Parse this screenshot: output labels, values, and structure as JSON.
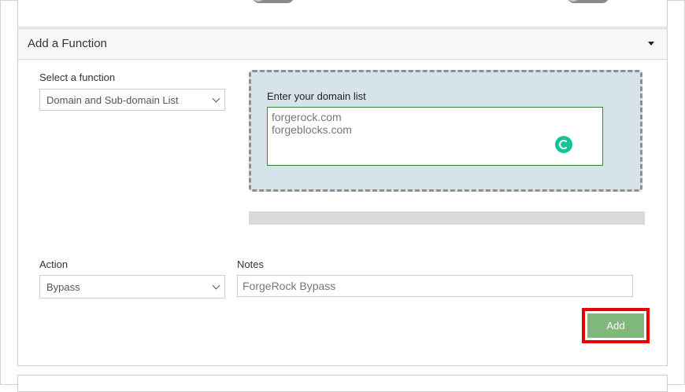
{
  "panel": {
    "title": "Add a Function"
  },
  "function_select": {
    "label": "Select a function",
    "value": "Domain and Sub-domain List"
  },
  "domain_list": {
    "label": "Enter your domain list",
    "lines": [
      "forgerock.com",
      "forgeblocks.com"
    ]
  },
  "action_select": {
    "label": "Action",
    "value": "Bypass"
  },
  "notes": {
    "label": "Notes",
    "value": "ForgeRock Bypass"
  },
  "add_button": {
    "label": "Add"
  },
  "colors": {
    "accent_green": "#7fb87a",
    "highlight_red": "#e60000",
    "dropzone_bg": "#d6e3eb",
    "grammarly_green": "#15c39a"
  }
}
